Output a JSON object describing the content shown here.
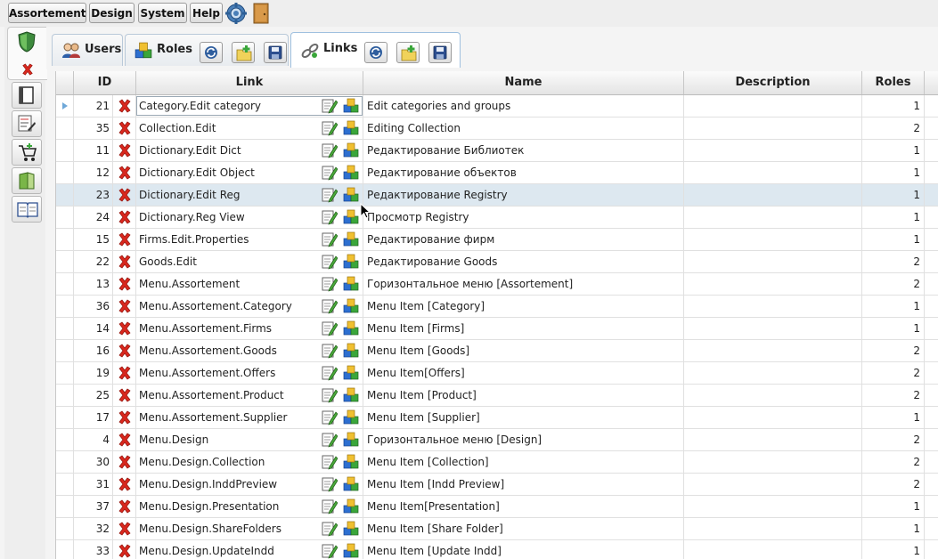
{
  "menu": {
    "items": [
      "Assortement",
      "Design",
      "System",
      "Help"
    ]
  },
  "tabs": [
    {
      "label": "Users",
      "icon": "users-icon"
    },
    {
      "label": "Roles",
      "icon": "roles-icon"
    },
    {
      "label": "Links",
      "icon": "links-icon",
      "active": true
    }
  ],
  "grid": {
    "columns": [
      "ID",
      "Link",
      "Name",
      "Description",
      "Roles"
    ],
    "selected_row": 4,
    "current_row": 0,
    "rows": [
      {
        "id": "21",
        "link": "Category.Edit category",
        "name": "Edit categories and groups",
        "description": "",
        "roles": "1"
      },
      {
        "id": "35",
        "link": "Collection.Edit",
        "name": "Editing Collection",
        "description": "",
        "roles": "2"
      },
      {
        "id": "11",
        "link": "Dictionary.Edit Dict",
        "name": "Редактирование Библиотек",
        "description": "",
        "roles": "1"
      },
      {
        "id": "12",
        "link": "Dictionary.Edit Object",
        "name": "Редактирование объектов",
        "description": "",
        "roles": "1"
      },
      {
        "id": "23",
        "link": "Dictionary.Edit Reg",
        "name": "Редактирование Registry",
        "description": "",
        "roles": "1"
      },
      {
        "id": "24",
        "link": "Dictionary.Reg View",
        "name": "Просмотр Registry",
        "description": "",
        "roles": "1"
      },
      {
        "id": "15",
        "link": "Firms.Edit.Properties",
        "name": "Редактирование фирм",
        "description": "",
        "roles": "1"
      },
      {
        "id": "22",
        "link": "Goods.Edit",
        "name": "Редактирование Goods",
        "description": "",
        "roles": "2"
      },
      {
        "id": "13",
        "link": "Menu.Assortement",
        "name": "Горизонтальное меню [Assortement]",
        "description": "",
        "roles": "2"
      },
      {
        "id": "36",
        "link": "Menu.Assortement.Category",
        "name": "Menu Item [Category]",
        "description": "",
        "roles": "1"
      },
      {
        "id": "14",
        "link": "Menu.Assortement.Firms",
        "name": "Menu Item [Firms]",
        "description": "",
        "roles": "1"
      },
      {
        "id": "16",
        "link": "Menu.Assortement.Goods",
        "name": "Menu Item [Goods]",
        "description": "",
        "roles": "2"
      },
      {
        "id": "19",
        "link": "Menu.Assortement.Offers",
        "name": "Menu Item[Offers]",
        "description": "",
        "roles": "2"
      },
      {
        "id": "25",
        "link": "Menu.Assortement.Product",
        "name": "Menu Item [Product]",
        "description": "",
        "roles": "2"
      },
      {
        "id": "17",
        "link": "Menu.Assortement.Supplier",
        "name": "Menu Item [Supplier]",
        "description": "",
        "roles": "1"
      },
      {
        "id": "4",
        "link": "Menu.Design",
        "name": "Горизонтальное меню [Design]",
        "description": "",
        "roles": "2"
      },
      {
        "id": "30",
        "link": "Menu.Design.Collection",
        "name": "Menu Item [Collection]",
        "description": "",
        "roles": "2"
      },
      {
        "id": "31",
        "link": "Menu.Design.InddPreview",
        "name": "Menu Item [Indd Preview]",
        "description": "",
        "roles": "2"
      },
      {
        "id": "37",
        "link": "Menu.Design.Presentation",
        "name": "Menu Item[Presentation]",
        "description": "",
        "roles": "1"
      },
      {
        "id": "32",
        "link": "Menu.Design.ShareFolders",
        "name": "Menu Item [Share Folder]",
        "description": "",
        "roles": "1"
      },
      {
        "id": "33",
        "link": "Menu.Design.UpdateIndd",
        "name": "Menu Item [Update Indd]",
        "description": "",
        "roles": "1"
      }
    ]
  },
  "colors": {
    "selected_row": "#dde8f0",
    "accent": "#6fa8d8",
    "delete_red": "#d9281e"
  }
}
